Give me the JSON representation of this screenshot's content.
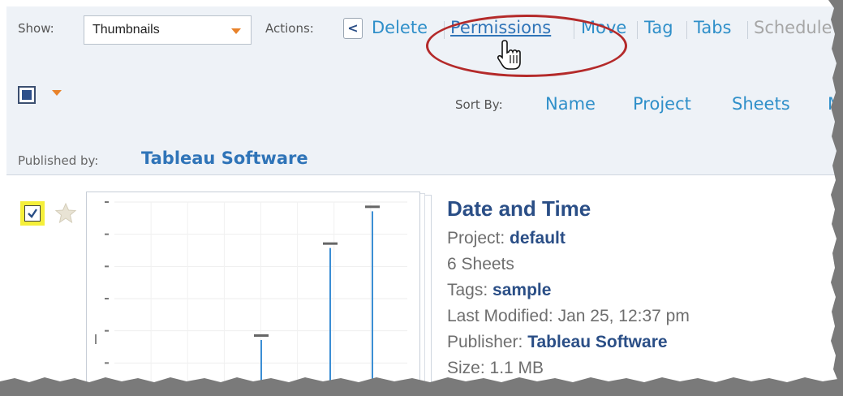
{
  "toolbar": {
    "show_label": "Show:",
    "show_value": "Thumbnails",
    "actions_label": "Actions:",
    "collapse_glyph": "<",
    "actions": [
      {
        "label": "Delete",
        "state": "active"
      },
      {
        "label": "Permissions",
        "state": "hovered"
      },
      {
        "label": "Move",
        "state": "active"
      },
      {
        "label": "Tag",
        "state": "active"
      },
      {
        "label": "Tabs",
        "state": "active"
      },
      {
        "label": "Schedule",
        "state": "disabled"
      }
    ],
    "sort_label": "Sort By:",
    "sort_items": [
      "Name",
      "Project",
      "Sheets",
      "M"
    ],
    "published_label": "Published by:",
    "published_value": "Tableau Software"
  },
  "workbook": {
    "title": "Date and Time",
    "project_label": "Project:",
    "project_value": "default",
    "sheets": "6 Sheets",
    "tags_label": "Tags:",
    "tags_value": "sample",
    "modified": "Last Modified: Jan 25, 12:37 pm",
    "publisher_label": "Publisher:",
    "publisher_value": "Tableau Software",
    "size": "Size: 1.1 MB",
    "checked": true,
    "favorite": false
  },
  "thumbnail_chart": {
    "type": "bar",
    "values": [
      2,
      1,
      30,
      2,
      80,
      100,
      2
    ],
    "ylim": [
      0,
      105
    ]
  },
  "colors": {
    "link": "#2f8fc9",
    "title": "#2a4e86",
    "highlight": "#b42a2a",
    "accent": "#e8822a",
    "toolbar_bg": "#eef2f7"
  },
  "icons": {
    "cursor": "hand-pointer-icon",
    "star": "star-icon",
    "dropdown": "chevron-down-icon",
    "collapse": "chevron-left-icon"
  }
}
